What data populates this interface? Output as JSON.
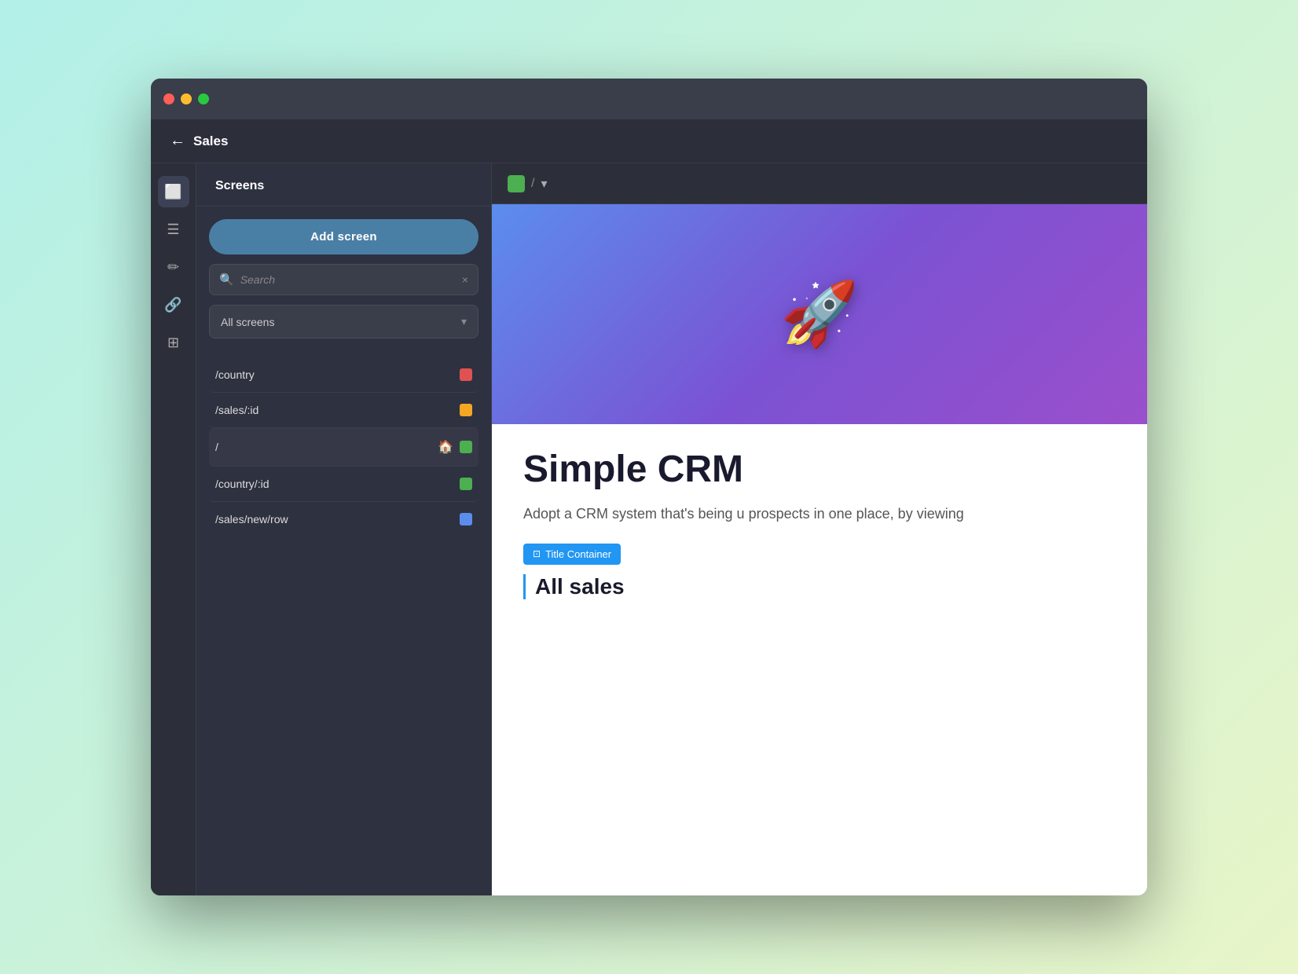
{
  "window": {
    "title": "Sales"
  },
  "titlebar": {
    "traffic_lights": [
      "red",
      "yellow",
      "green"
    ]
  },
  "header": {
    "back_label": "Sales",
    "back_arrow": "←"
  },
  "sidebar": {
    "items": [
      {
        "id": "screens",
        "icon": "⬜",
        "label": "Screens",
        "active": true
      },
      {
        "id": "list",
        "icon": "☰",
        "label": "List"
      },
      {
        "id": "brush",
        "icon": "✏️",
        "label": "Brush"
      },
      {
        "id": "link",
        "icon": "🔗",
        "label": "Link"
      },
      {
        "id": "table",
        "icon": "⊞",
        "label": "Table"
      }
    ]
  },
  "screens_panel": {
    "title": "Screens",
    "add_button_label": "Add screen",
    "search": {
      "placeholder": "Search",
      "value": "",
      "clear_icon": "×"
    },
    "filter_dropdown": {
      "label": "All screens",
      "arrow_icon": "⌄"
    },
    "screen_list": [
      {
        "name": "/country",
        "color": "#e05252",
        "is_home": false
      },
      {
        "name": "/sales/:id",
        "color": "#f5a623",
        "is_home": false
      },
      {
        "name": "/",
        "color": "#4caf50",
        "is_home": true,
        "active": true
      },
      {
        "name": "/country/:id",
        "color": "#4caf50",
        "is_home": false
      },
      {
        "name": "/sales/new/row",
        "color": "#5b8dee",
        "is_home": false
      }
    ]
  },
  "preview": {
    "toolbar": {
      "color": "#4caf50",
      "slash": "/",
      "chevron": "⌄"
    },
    "hero": {
      "emoji": "🚀"
    },
    "body": {
      "app_title": "Simple CRM",
      "app_description": "Adopt a CRM system that's being u prospects in one place, by viewing",
      "badge_label": "Title Container",
      "badge_icon": "⋯",
      "all_sales_label": "All sales"
    }
  },
  "colors": {
    "bg_primary": "#2c2f3a",
    "bg_secondary": "#2e3140",
    "bg_panel": "#3a3d4a",
    "accent_blue": "#4a7fa5",
    "accent_green": "#4caf50",
    "text_primary": "#ffffff",
    "text_secondary": "#aaaaaa"
  }
}
